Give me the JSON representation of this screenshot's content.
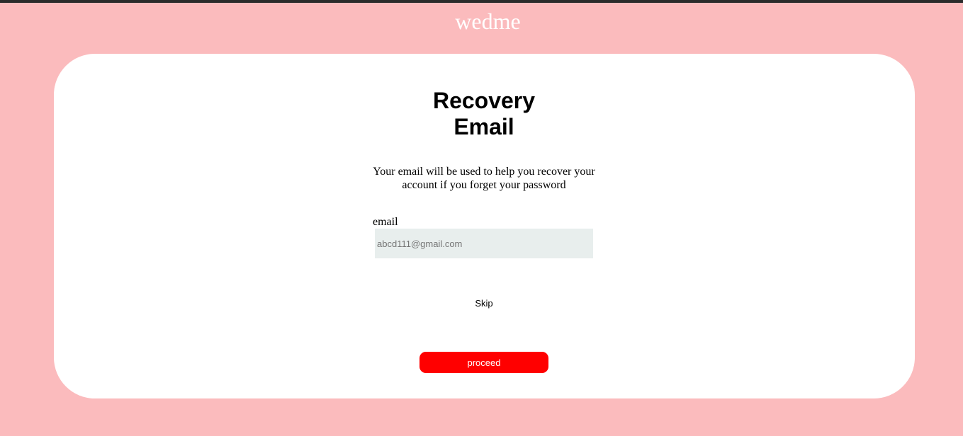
{
  "header": {
    "brand": "wedme"
  },
  "recovery": {
    "title_line1": "Recovery",
    "title_line2": "Email",
    "description": "Your email will be used to help you recover your account if you forget your password",
    "email_label": "email",
    "email_placeholder": "abcd111@gmail.com",
    "email_value": "",
    "skip_label": "Skip",
    "proceed_label": "proceed"
  },
  "colors": {
    "background": "#fbbbbd",
    "card": "#ffffff",
    "input_background": "#e8eeed",
    "primary_button": "#ff0000",
    "brand_text": "#ffffff"
  }
}
